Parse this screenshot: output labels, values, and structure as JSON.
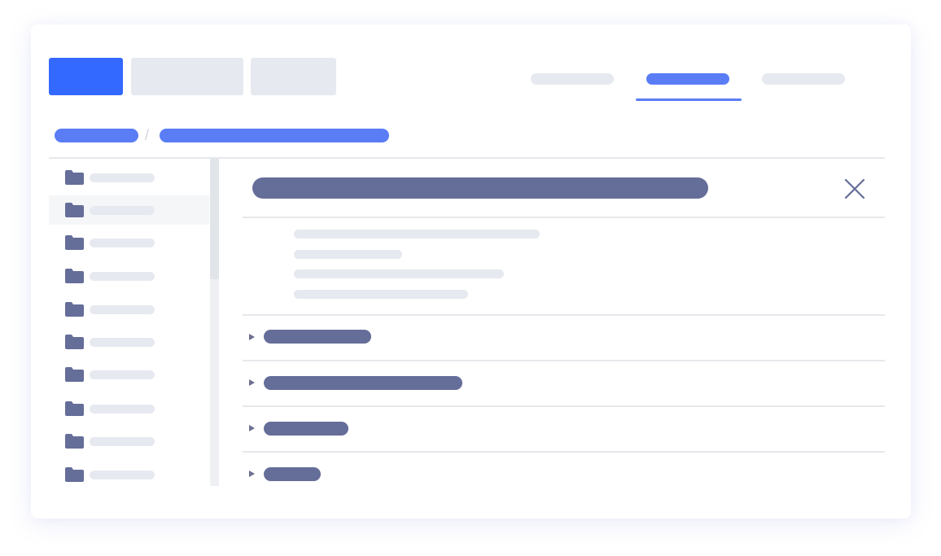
{
  "colors": {
    "accent": "#3469ff",
    "brand_light": "#5a7df6",
    "navy": "#656d99",
    "placeholder": "#e6e9ef",
    "divider": "#e6e8ec"
  },
  "toolbar": {
    "buttons": [
      {
        "role": "primary"
      },
      {
        "role": "secondary"
      },
      {
        "role": "secondary"
      }
    ]
  },
  "tabs": {
    "items": [
      {
        "active": false
      },
      {
        "active": true
      },
      {
        "active": false
      }
    ],
    "active_index": 1
  },
  "breadcrumb": {
    "separator": "/"
  },
  "sidebar": {
    "item_count": 10,
    "selected_index": 1,
    "icon": "folder-icon"
  },
  "panel": {
    "close_icon": "close-icon",
    "detail_lines": 4,
    "sections": 4,
    "section_icon": "caret-right-icon"
  }
}
